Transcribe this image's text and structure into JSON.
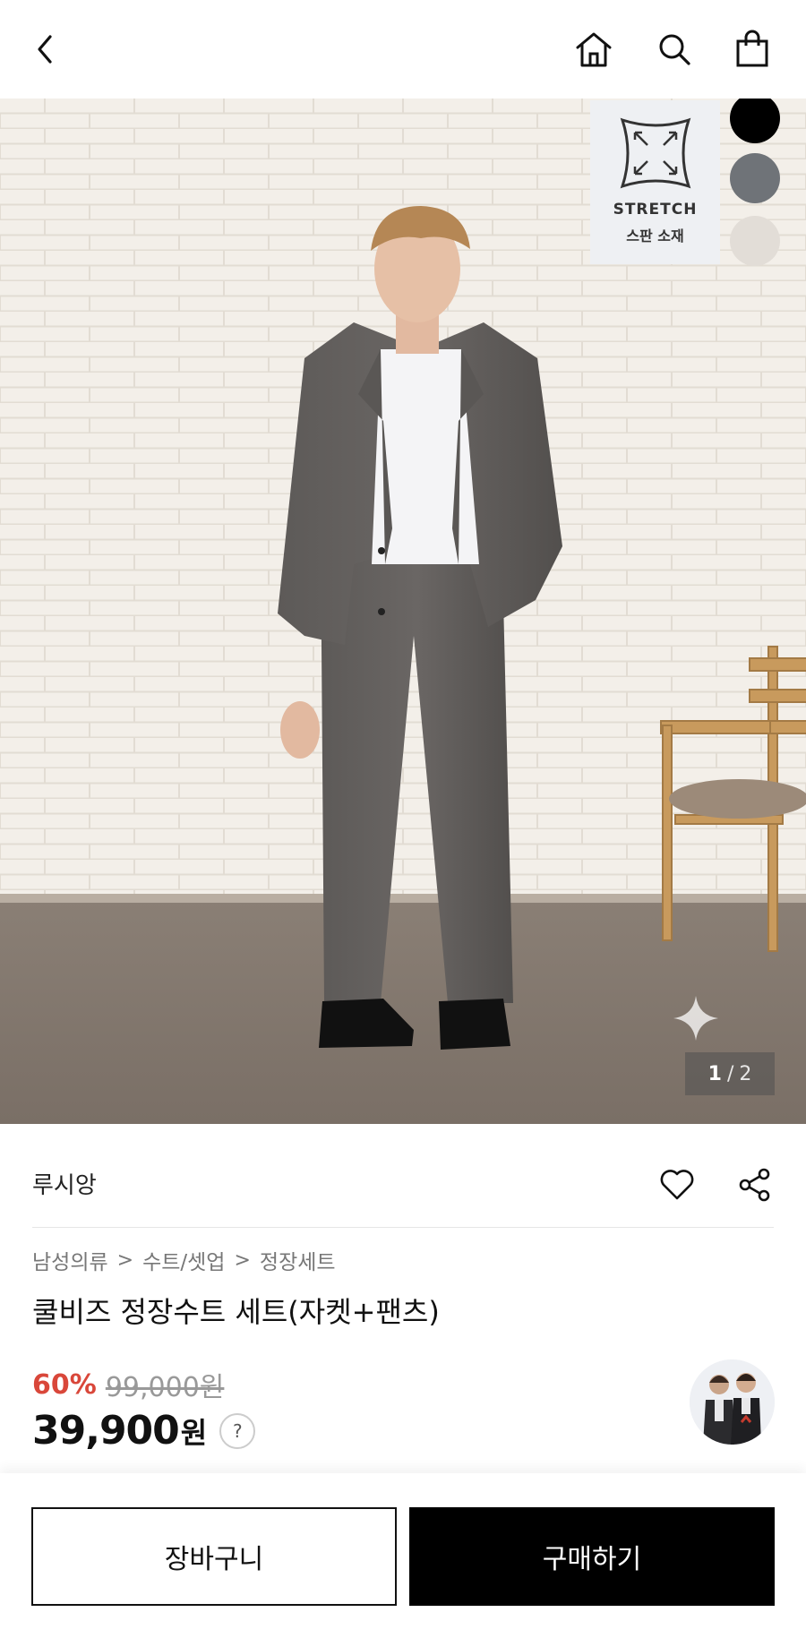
{
  "header": {
    "back_icon": "chevron-left-icon",
    "home_icon": "home-icon",
    "search_icon": "search-icon",
    "bag_icon": "shopping-bag-icon"
  },
  "hero": {
    "badge_title": "STRETCH",
    "badge_subtitle": "스판 소재",
    "swatches": [
      "#000000",
      "#6f7378",
      "#e2ddd7"
    ],
    "image_index": "1",
    "image_total": "2"
  },
  "product": {
    "brand": "루시앙",
    "breadcrumb": [
      "남성의류",
      "수트/셋업",
      "정장세트"
    ],
    "title": "쿨비즈 정장수트 세트(자켓+팬츠)",
    "discount": "60%",
    "original_price": "99,000원",
    "price": "39,900",
    "currency": "원",
    "help": "?"
  },
  "actions": {
    "cart_label": "장바구니",
    "buy_label": "구매하기"
  },
  "colors": {
    "discount": "#d9473a",
    "buy_button": "#000000"
  }
}
